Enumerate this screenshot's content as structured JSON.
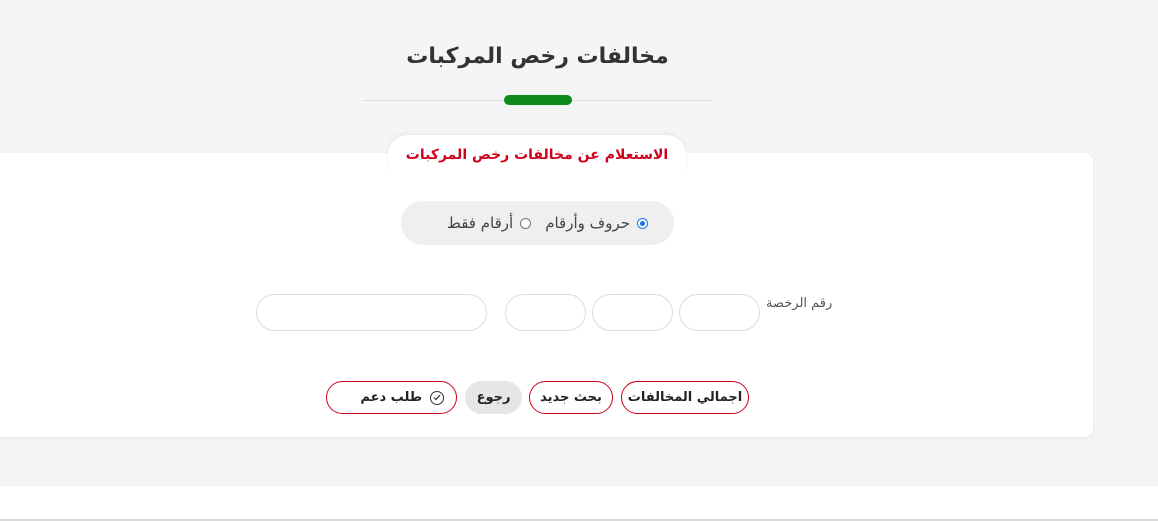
{
  "page": {
    "title": "مخالفات رخص المركبات"
  },
  "card": {
    "tab_label": "الاستعلام عن مخالفات رخص المركبات"
  },
  "plate_type": {
    "options": [
      {
        "label": "حروف وأرقام",
        "selected": true
      },
      {
        "label": "أرقام فقط",
        "selected": false
      }
    ]
  },
  "plate": {
    "label": "رقم الرخصة",
    "letter_1": "",
    "letter_2": "",
    "letter_3": "",
    "number": ""
  },
  "actions": {
    "total_violations": "اجمالي المخالفات",
    "new_search": "بحث جديد",
    "back": "رجوع",
    "support_request": "طلب دعم"
  },
  "colors": {
    "accent_green": "#0e8a1a",
    "accent_red": "#d0021b",
    "radio_blue": "#1a73e8"
  },
  "icons": {
    "support_request": "check-circle-icon"
  }
}
